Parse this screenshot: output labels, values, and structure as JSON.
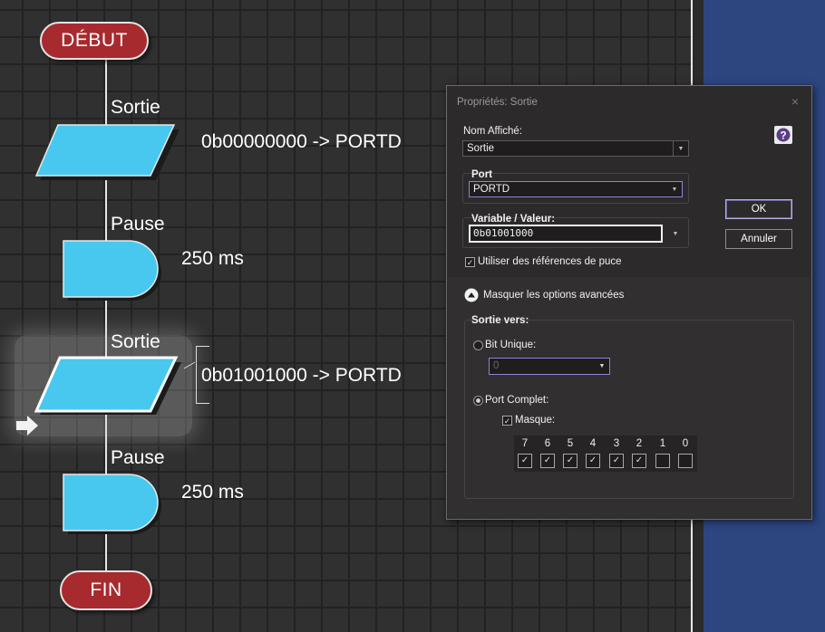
{
  "flowchart": {
    "start_label": "DÉBUT",
    "end_label": "FIN",
    "blocks": [
      {
        "label": "Sortie",
        "text": "0b00000000 -> PORTD"
      },
      {
        "label": "Pause",
        "text": "250 ms"
      },
      {
        "label": "Sortie",
        "text": "0b01001000 -> PORTD"
      },
      {
        "label": "Pause",
        "text": "250 ms"
      }
    ],
    "colors": {
      "io_fill": "#47c7ee",
      "terminal_fill": "#a72a2e",
      "grid": "#222222"
    }
  },
  "dialog": {
    "title": "Propriétés: Sortie",
    "close_glyph": "×",
    "display_name_label": "Nom Affiché:",
    "display_name_value": "Sortie",
    "port_label": "Port",
    "port_value": "PORTD",
    "variable_label": "Variable / Valeur:",
    "variable_value": "0b01001000",
    "use_chip_refs_label": "Utiliser des références de puce",
    "use_chip_refs_checked": true,
    "ok_label": "OK",
    "cancel_label": "Annuler",
    "advanced_toggle_label": "Masquer les options avancées",
    "output_to_label": "Sortie vers:",
    "single_bit_label": "Bit Unique:",
    "single_bit_value": "0",
    "full_port_label": "Port Complet:",
    "mask_label": "Masque:",
    "mask_checked": true,
    "bits": [
      {
        "n": "7",
        "checked": true
      },
      {
        "n": "6",
        "checked": true
      },
      {
        "n": "5",
        "checked": true
      },
      {
        "n": "4",
        "checked": true
      },
      {
        "n": "3",
        "checked": true
      },
      {
        "n": "2",
        "checked": true
      },
      {
        "n": "1",
        "checked": false
      },
      {
        "n": "0",
        "checked": false
      }
    ]
  }
}
